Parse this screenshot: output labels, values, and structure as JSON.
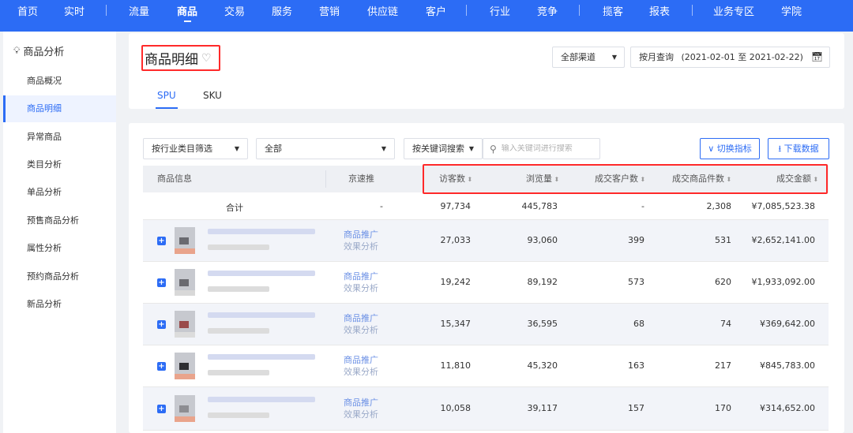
{
  "topnav": {
    "items": [
      {
        "label": "首页"
      },
      {
        "label": "实时"
      },
      {
        "label": "流量"
      },
      {
        "label": "商品"
      },
      {
        "label": "交易"
      },
      {
        "label": "服务"
      },
      {
        "label": "营销"
      },
      {
        "label": "供应链"
      },
      {
        "label": "客户"
      },
      {
        "label": "行业"
      },
      {
        "label": "竞争"
      },
      {
        "label": "揽客"
      },
      {
        "label": "报表"
      },
      {
        "label": "业务专区"
      },
      {
        "label": "学院"
      }
    ],
    "active": "商品"
  },
  "sidebar": {
    "header": "商品分析",
    "items": [
      {
        "label": "商品概况"
      },
      {
        "label": "商品明细"
      },
      {
        "label": "异常商品"
      },
      {
        "label": "类目分析"
      },
      {
        "label": "单品分析"
      },
      {
        "label": "预售商品分析"
      },
      {
        "label": "属性分析"
      },
      {
        "label": "预约商品分析"
      },
      {
        "label": "新品分析"
      }
    ],
    "active": "商品明细"
  },
  "header": {
    "title": "商品明细",
    "channel": "全部渠道",
    "date_label": "按月查询",
    "date_range": "(2021-02-01 至 2021-02-22)",
    "tabs": [
      {
        "label": "SPU"
      },
      {
        "label": "SKU"
      }
    ]
  },
  "filters": {
    "industry_filter": "按行业类目筛选",
    "category_value": "全部",
    "keyword_mode": "按关键词搜索",
    "search_placeholder": "输入关键词进行搜索",
    "switch_metrics": "切换指标",
    "download": "下载数据"
  },
  "table": {
    "columns": [
      "商品信息",
      "京速推",
      "访客数",
      "浏览量",
      "成交客户数",
      "成交商品件数",
      "成交金额"
    ],
    "total": {
      "label": "合计",
      "jst": "-",
      "visitors": "97,734",
      "pageviews": "445,783",
      "customers": "-",
      "items": "2,308",
      "amount": "¥7,085,523.38"
    },
    "link1": "商品推广",
    "link2": "效果分析",
    "rows": [
      {
        "visitors": "27,033",
        "pageviews": "93,060",
        "customers": "399",
        "items": "531",
        "amount": "¥2,652,141.00"
      },
      {
        "visitors": "19,242",
        "pageviews": "89,192",
        "customers": "573",
        "items": "620",
        "amount": "¥1,933,092.00"
      },
      {
        "visitors": "15,347",
        "pageviews": "36,595",
        "customers": "68",
        "items": "74",
        "amount": "¥369,642.00"
      },
      {
        "visitors": "11,810",
        "pageviews": "45,320",
        "customers": "163",
        "items": "217",
        "amount": "¥845,783.00"
      },
      {
        "visitors": "10,058",
        "pageviews": "39,117",
        "customers": "157",
        "items": "170",
        "amount": "¥314,652.00"
      }
    ]
  },
  "colors": {
    "primary": "#2c6cf5",
    "highlight_box": "#ff2a2a"
  }
}
